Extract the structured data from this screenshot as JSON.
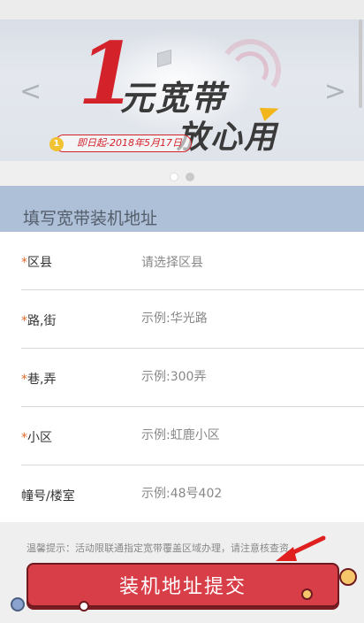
{
  "banner": {
    "big_number": "1",
    "title_line1": "元宽带",
    "title_line2": "放心用",
    "date_text": "即日起-2018年5月17日",
    "coin_text": "1",
    "prev_arrow": "<",
    "next_arrow": ">"
  },
  "carousel": {
    "dot_count": 2,
    "active_index": 1
  },
  "section": {
    "title": "填写宽带装机地址"
  },
  "form": {
    "rows": [
      {
        "required": true,
        "label": "区县",
        "type": "select",
        "value": "请选择区县"
      },
      {
        "required": true,
        "label": "路,街",
        "type": "input",
        "placeholder": "示例:华光路"
      },
      {
        "required": true,
        "label": "巷,弄",
        "type": "input",
        "placeholder": "示例:300弄"
      },
      {
        "required": true,
        "label": "小区",
        "type": "input",
        "placeholder": "示例:虹鹿小区"
      },
      {
        "required": false,
        "label": "幢号/楼室",
        "type": "input",
        "placeholder": "示例:48号402"
      }
    ],
    "required_mark": "*"
  },
  "tip": {
    "text": "温馨提示：活动限联通指定宽带覆盖区域办理，请注意核查资"
  },
  "submit": {
    "label": "装机地址提交"
  },
  "colors": {
    "accent": "#d83e48",
    "header_bg": "#aebfd8",
    "required": "#e06a2a"
  }
}
